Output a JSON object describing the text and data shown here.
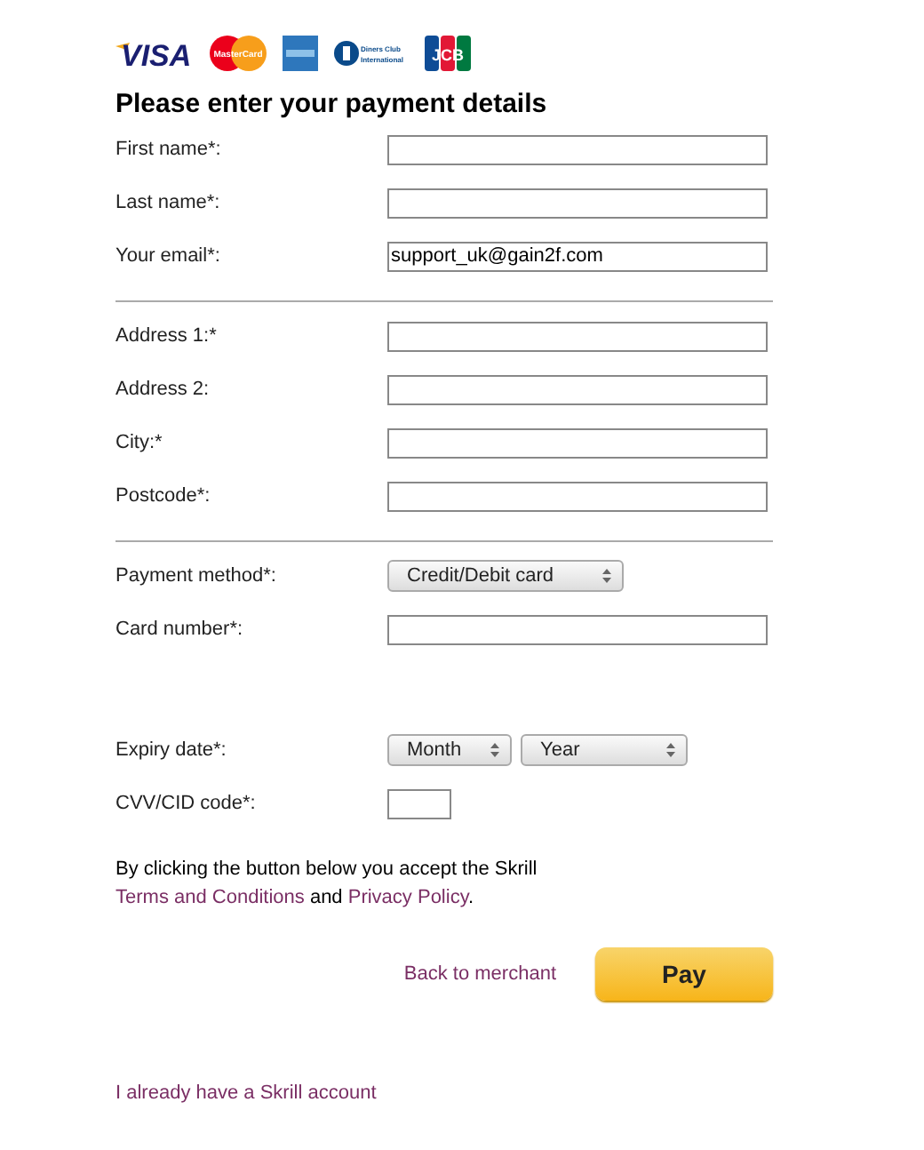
{
  "card_logos": [
    {
      "kind": "visa",
      "label": "VISA"
    },
    {
      "kind": "mastercard",
      "label": "MasterCard"
    },
    {
      "kind": "amex"
    },
    {
      "kind": "diners",
      "label": "Diners Club International"
    },
    {
      "kind": "jcb",
      "label": "JCB"
    }
  ],
  "heading": "Please enter your payment details",
  "sections": [
    {
      "fields": [
        {
          "kind": "text",
          "label": "First name*:"
        },
        {
          "kind": "text",
          "label": "Last name*:"
        },
        {
          "kind": "text",
          "label": "Your email*:",
          "value": "support_uk@gain2f.com"
        }
      ]
    },
    {
      "fields": [
        {
          "kind": "text",
          "label": "Address 1:*"
        },
        {
          "kind": "text",
          "label": "Address 2:"
        },
        {
          "kind": "text",
          "label": "City:*"
        },
        {
          "kind": "text",
          "label": "Postcode*:"
        }
      ]
    },
    {
      "fields": [
        {
          "kind": "select",
          "label": "Payment method*:",
          "options": [
            "Credit/Debit card"
          ]
        },
        {
          "kind": "text",
          "label": "Card number*:"
        },
        {
          "kind": "spacer"
        },
        {
          "kind": "select",
          "label": "Expiry date*:",
          "options": [
            "Month",
            "Year"
          ]
        },
        {
          "kind": "short",
          "label": "CVV/CID code*:"
        }
      ]
    }
  ],
  "notice": {
    "text": "By clicking the button below you accept the Skrill",
    "terms_link": "Terms and Conditions",
    "conjunction": "and",
    "privacy_link": "Privacy Policy",
    "end": "."
  },
  "back_link": "Back to merchant",
  "pay_button": "Pay",
  "account_link": "I already have a Skrill account"
}
